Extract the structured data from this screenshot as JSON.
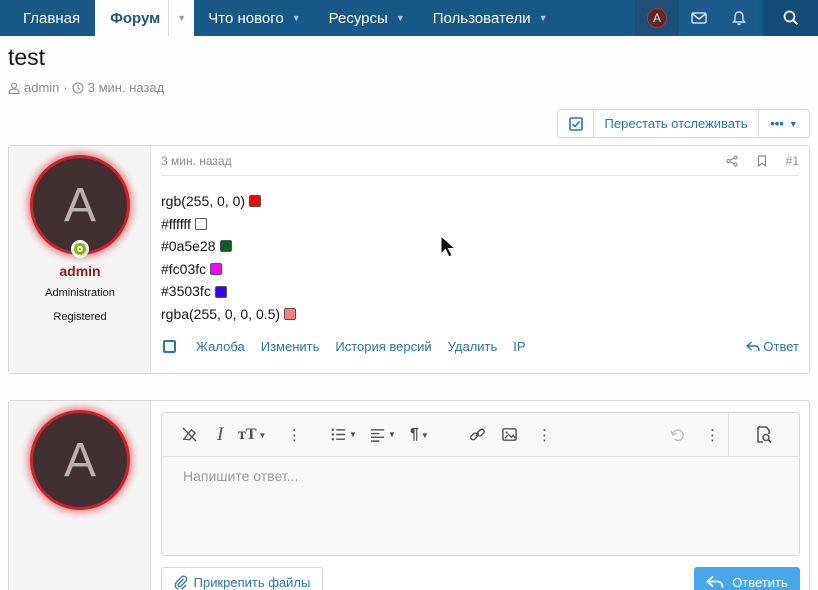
{
  "nav": {
    "home": "Главная",
    "forum": "Форум",
    "whats_new": "Что нового",
    "resources": "Ресурсы",
    "users": "Пользователи",
    "avatar_letter": "A"
  },
  "thread": {
    "title": "test",
    "author": "admin",
    "time": "3 мин. назад"
  },
  "actions": {
    "unwatch": "Перестать отслеживать",
    "more": "•••"
  },
  "post": {
    "avatar_letter": "A",
    "username": "admin",
    "role1": "Administration",
    "role2": "Registered",
    "time": "3 мин. назад",
    "number": "#1",
    "lines": [
      {
        "text": "rgb(255, 0, 0)",
        "color": "#ff0000"
      },
      {
        "text": "#ffffff",
        "color": "#ffffff"
      },
      {
        "text": "#0a5e28",
        "color": "#0a5e28"
      },
      {
        "text": "#fc03fc",
        "color": "#fc03fc"
      },
      {
        "text": "#3503fc",
        "color": "#3503fc"
      },
      {
        "text": "rgba(255, 0, 0, 0.5)",
        "color": "rgba(255, 0, 0, 0.5)"
      }
    ],
    "footer": {
      "report": "Жалоба",
      "edit": "Изменить",
      "history": "История версий",
      "delete": "Удалить",
      "ip": "IP",
      "reply": "Ответ"
    }
  },
  "reply": {
    "avatar_letter": "A",
    "placeholder": "Напишите ответ...",
    "attach": "Прикрепить файлы",
    "submit": "Ответить"
  },
  "colors": {
    "nav_bg": "#185886",
    "link": "#2577b1",
    "submit_bg": "#47a7eb",
    "username": "#8f1b1b"
  }
}
